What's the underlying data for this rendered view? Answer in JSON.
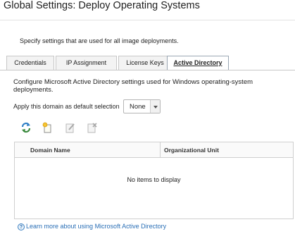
{
  "page": {
    "title": "Global Settings: Deploy Operating Systems",
    "description": "Specify settings that are used for all image deployments."
  },
  "tabs": [
    {
      "label": "Credentials",
      "active": false
    },
    {
      "label": "IP Assignment",
      "active": false
    },
    {
      "label": "License Keys",
      "active": false
    },
    {
      "label": "Active Directory",
      "active": true
    }
  ],
  "active_directory": {
    "intro": "Configure Microsoft Active Directory settings used for Windows operating-system deployments.",
    "default_domain_label": "Apply this domain as default selection",
    "default_domain_value": "None"
  },
  "toolbar": {
    "icons": [
      "refresh-icon",
      "add-icon",
      "edit-icon",
      "delete-icon"
    ]
  },
  "table": {
    "columns": [
      "Domain Name",
      "Organizational Unit"
    ],
    "rows": [],
    "empty_message": "No items to display"
  },
  "help": {
    "link_text": "Learn more about using Microsoft Active Directory",
    "icon": "help-icon",
    "icon_glyph": "?"
  },
  "colors": {
    "link": "#2a6fb6",
    "tab_border_active": "#9aa6b3"
  }
}
